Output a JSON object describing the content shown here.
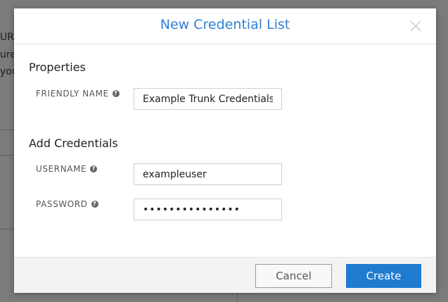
{
  "background": {
    "text_fragments": [
      "URL",
      "ure t",
      "you"
    ]
  },
  "modal": {
    "title": "New Credential List",
    "close_icon": "close-icon",
    "properties": {
      "heading": "Properties",
      "friendly_name": {
        "label": "FRIENDLY NAME",
        "value": "Example Trunk Credentials"
      }
    },
    "credentials": {
      "heading": "Add Credentials",
      "username": {
        "label": "USERNAME",
        "value": "exampleuser"
      },
      "password": {
        "label": "PASSWORD",
        "value": "•••••••••••••••"
      }
    },
    "footer": {
      "cancel_label": "Cancel",
      "create_label": "Create"
    }
  },
  "colors": {
    "title": "#2f7fd3",
    "primary_button": "#1f7bd0",
    "overlay": "#7b7b7b"
  },
  "icons": {
    "help": "?"
  }
}
